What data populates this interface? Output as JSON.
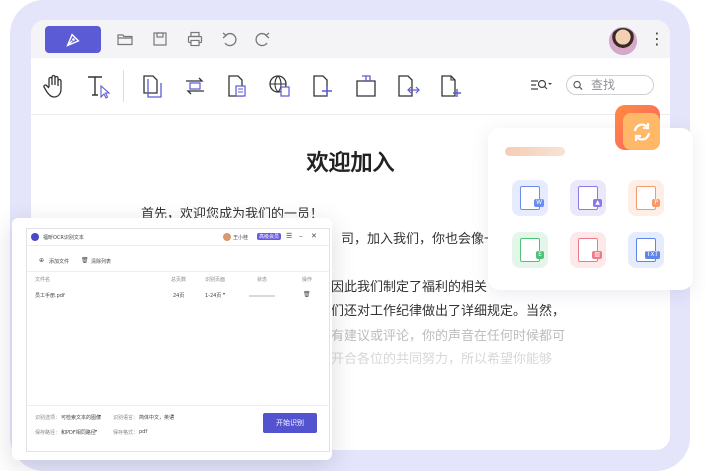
{
  "colors": {
    "accent": "#5b5bd6",
    "frame": "#e4e4fb",
    "pro_badge": "#6a5ae0"
  },
  "search": {
    "placeholder": "查找"
  },
  "document": {
    "title": "欢迎加入",
    "lines": [
      "首先，欢迎您成为我们的一员！",
      "司，加入我们，你也会像一",
      "因此我们制定了福利的相关",
      "们还对工作纪律做出了详细规定。当然，",
      "有建议或评论，你的声音在任何时候都可",
      "开合各位的共同努力，所以希望你能够"
    ]
  },
  "format_tiles": [
    "W",
    "image",
    "P",
    "E",
    "pdf",
    "TXT"
  ],
  "ocr": {
    "window_title": "福昕OCR识别文本",
    "user_name": "王小桂",
    "pro_badge": "高级会员",
    "add_file": "添加文件",
    "clear_list": "清除列表",
    "columns": [
      "文件名",
      "总页数",
      "识别页面",
      "状态",
      "操作"
    ],
    "row": {
      "name": "员工手册.pdf",
      "pages": "24页",
      "range": "1-24页"
    },
    "footer": {
      "recognize_label": "识别选项：",
      "recognize_value": "可检索文本的图像",
      "language_label": "识别语言：",
      "language_value": "简体中文，英语",
      "output_label": "保存路径：",
      "output_value": "和PDF相同路径",
      "format_label": "保存格式：",
      "format_value": "pdf"
    },
    "start_button": "开始识别"
  }
}
